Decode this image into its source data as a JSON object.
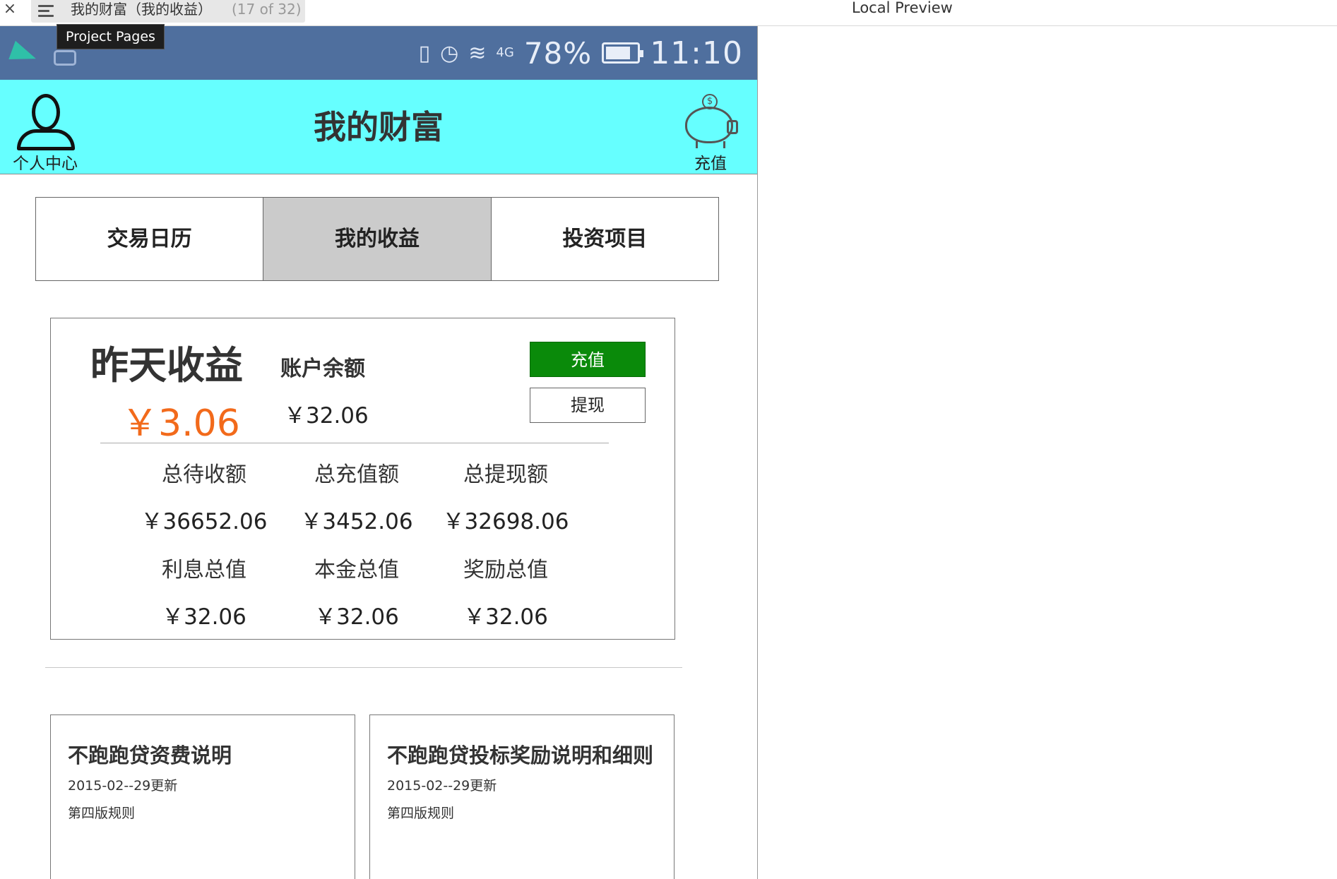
{
  "chrome": {
    "close": "×",
    "page_title": "我的财富（我的收益）",
    "page_count": "(17 of 32)",
    "preview_label": "Local Preview",
    "tooltip": "Project Pages"
  },
  "statusbar": {
    "battery": "78%",
    "time": "11:10",
    "network": "4G"
  },
  "appbar": {
    "profile_label": "个人中心",
    "title": "我的财富",
    "recharge_label": "充值",
    "coin_symbol": "$"
  },
  "tabs": [
    {
      "label": "交易日历",
      "active": false
    },
    {
      "label": "我的收益",
      "active": true
    },
    {
      "label": "投资项目",
      "active": false
    }
  ],
  "summary": {
    "yesterday_title": "昨天收益",
    "yesterday_value": "￥3.06",
    "balance_title": "账户余额",
    "balance_value": "￥32.06",
    "recharge_button": "充值",
    "withdraw_button": "提现",
    "stats": [
      {
        "label": "总待收额",
        "value": "￥36652.06"
      },
      {
        "label": "总充值额",
        "value": "￥3452.06"
      },
      {
        "label": "总提现额",
        "value": "￥32698.06"
      },
      {
        "label": "利息总值",
        "value": "￥32.06"
      },
      {
        "label": "本金总值",
        "value": "￥32.06"
      },
      {
        "label": "奖励总值",
        "value": "￥32.06"
      }
    ]
  },
  "articles": [
    {
      "title": "不跑跑贷资费说明",
      "date": "2015-02--29更新",
      "version": "第四版规则"
    },
    {
      "title": "不跑跑贷投标奖励说明和细则",
      "date": "2015-02--29更新",
      "version": "第四版规则"
    }
  ],
  "colors": {
    "appbar": "#66ffff",
    "statusbar": "#4f6f9e",
    "accent_orange": "#f26a1b",
    "button_green": "#0a8a0a",
    "active_tab": "#cbcbcb"
  }
}
